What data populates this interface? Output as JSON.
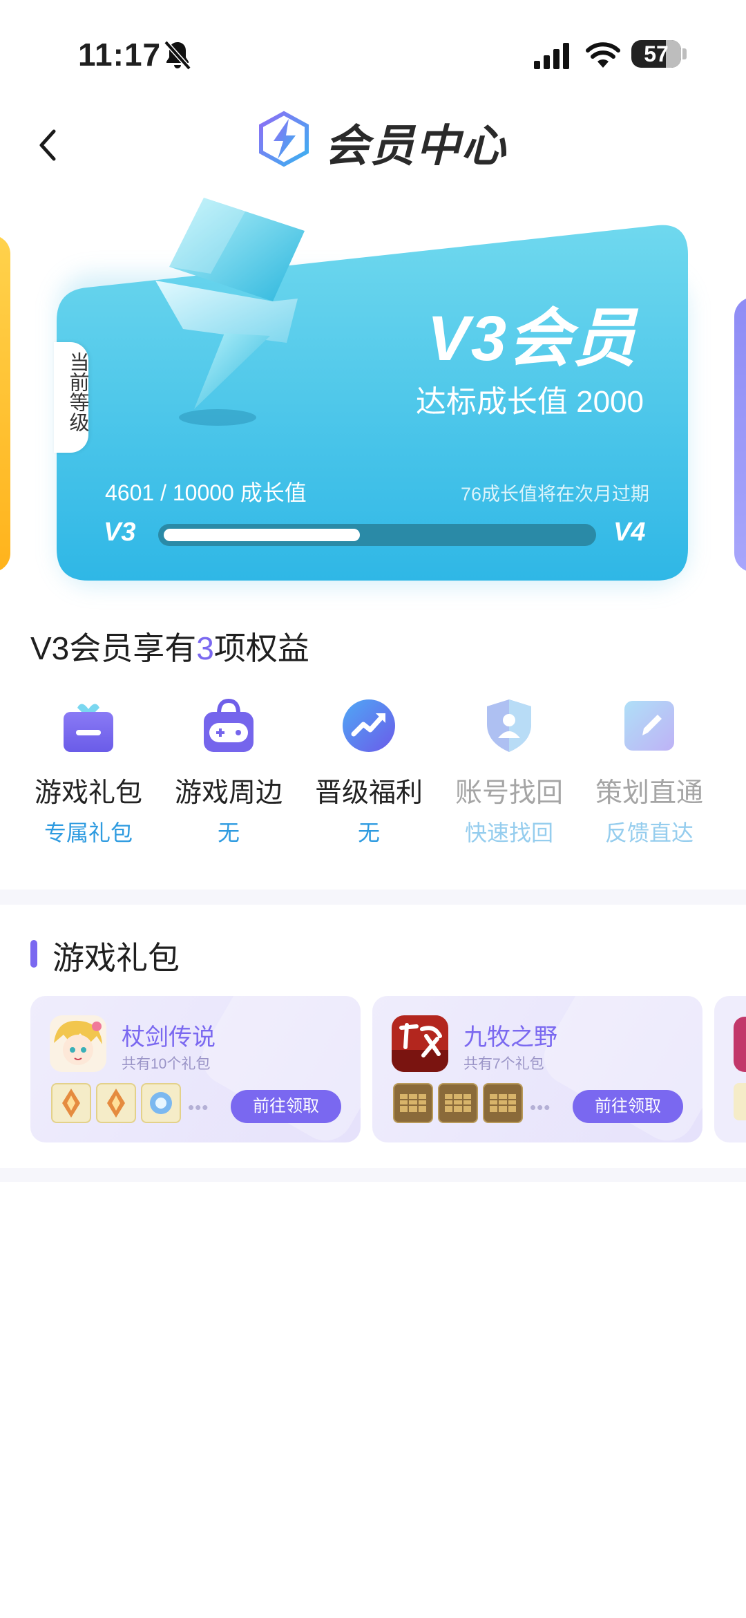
{
  "status_bar": {
    "time": "11:17",
    "battery": "57"
  },
  "header": {
    "title": "会员中心"
  },
  "card": {
    "side_tag": "当前等级",
    "level_title": "V3会员",
    "threshold_text": "达标成长值 2000",
    "growth_progress_text": "4601 / 10000 成长值",
    "expire_note": "76成长值将在次月过期",
    "level_from": "V3",
    "level_to": "V4",
    "progress_fraction": 0.4601
  },
  "benefits": {
    "title_prefix": "V3会员享有",
    "title_count": "3",
    "title_suffix": "项权益",
    "items": [
      {
        "name": "游戏礼包",
        "sub": "专属礼包",
        "icon": "gift-box-icon",
        "active": true
      },
      {
        "name": "游戏周边",
        "sub": "无",
        "icon": "gamepad-bag-icon",
        "active": true
      },
      {
        "name": "晋级福利",
        "sub": "无",
        "icon": "trend-up-icon",
        "active": true
      },
      {
        "name": "账号找回",
        "sub": "快速找回",
        "icon": "shield-user-icon",
        "active": false
      },
      {
        "name": "策划直通",
        "sub": "反馈直达",
        "icon": "pencil-icon",
        "active": false
      }
    ]
  },
  "gift_section": {
    "title": "游戏礼包",
    "cards": [
      {
        "game": "杖剑传说",
        "count_text": "共有10个礼包",
        "button": "前往领取",
        "more": "•••"
      },
      {
        "game": "九牧之野",
        "count_text": "共有7个礼包",
        "button": "前往领取",
        "more": "•••"
      }
    ]
  },
  "colors": {
    "accent": "#7a68f0",
    "card_cyan": "#45c3e8",
    "link_blue": "#2e9be0"
  }
}
